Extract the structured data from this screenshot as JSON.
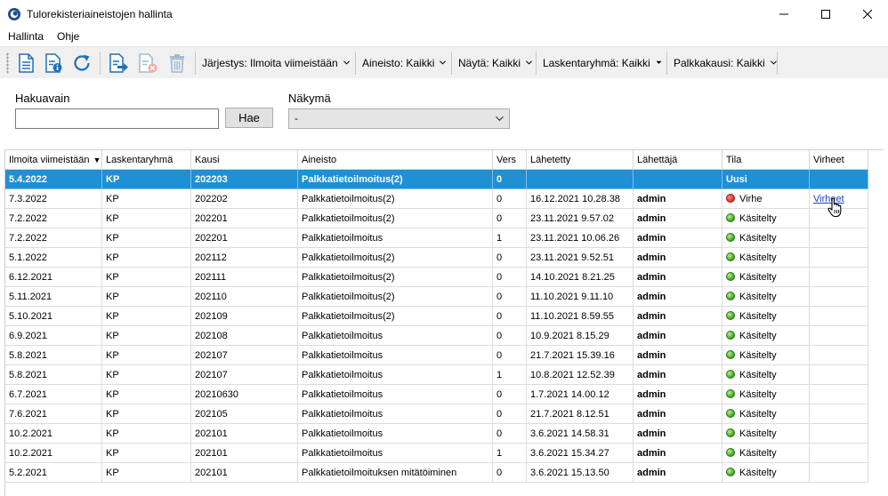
{
  "window": {
    "title": "Tulorekisteriaineistojen hallinta"
  },
  "menu": {
    "items": [
      "Hallinta",
      "Ohje"
    ]
  },
  "toolbar": {
    "dropdowns": [
      "Järjestys: Ilmoita viimeistään",
      "Aineisto: Kaikki",
      "Näytä: Kaikki",
      "Laskentaryhmä: Kaikki",
      "Palkkakausi: Kaikki"
    ]
  },
  "search": {
    "label": "Hakuavain",
    "value": "",
    "button": "Hae"
  },
  "view": {
    "label": "Näkymä",
    "selected": "-"
  },
  "grid": {
    "columns": [
      "Ilmoita viimeistään",
      "Laskentaryhmä",
      "Kausi",
      "Aineisto",
      "Vers",
      "Lähetetty",
      "Lähettäjä",
      "Tila",
      "Virheet"
    ],
    "sort_indicator": "▼",
    "rows": [
      [
        "5.4.2022",
        "KP",
        "202203",
        "Palkkatietoilmoitus(2)",
        "0",
        "",
        "",
        "Uusi",
        ""
      ],
      [
        "7.3.2022",
        "KP",
        "202202",
        "Palkkatietoilmoitus(2)",
        "0",
        "16.12.2021 10.28.38",
        "admin",
        "Virhe",
        "Virheet"
      ],
      [
        "7.2.2022",
        "KP",
        "202201",
        "Palkkatietoilmoitus(2)",
        "0",
        "23.11.2021 9.57.02",
        "admin",
        "Käsitelty",
        ""
      ],
      [
        "7.2.2022",
        "KP",
        "202201",
        "Palkkatietoilmoitus",
        "1",
        "23.11.2021 10.06.26",
        "admin",
        "Käsitelty",
        ""
      ],
      [
        "5.1.2022",
        "KP",
        "202112",
        "Palkkatietoilmoitus(2)",
        "0",
        "23.11.2021 9.52.51",
        "admin",
        "Käsitelty",
        ""
      ],
      [
        "6.12.2021",
        "KP",
        "202111",
        "Palkkatietoilmoitus(2)",
        "0",
        "14.10.2021 8.21.25",
        "admin",
        "Käsitelty",
        ""
      ],
      [
        "5.11.2021",
        "KP",
        "202110",
        "Palkkatietoilmoitus(2)",
        "0",
        "11.10.2021 9.11.10",
        "admin",
        "Käsitelty",
        ""
      ],
      [
        "5.10.2021",
        "KP",
        "202109",
        "Palkkatietoilmoitus(2)",
        "0",
        "11.10.2021 8.59.55",
        "admin",
        "Käsitelty",
        ""
      ],
      [
        "6.9.2021",
        "KP",
        "202108",
        "Palkkatietoilmoitus",
        "0",
        "10.9.2021 8.15.29",
        "admin",
        "Käsitelty",
        ""
      ],
      [
        "5.8.2021",
        "KP",
        "202107",
        "Palkkatietoilmoitus",
        "0",
        "21.7.2021 15.39.16",
        "admin",
        "Käsitelty",
        ""
      ],
      [
        "5.8.2021",
        "KP",
        "202107",
        "Palkkatietoilmoitus",
        "1",
        "10.8.2021 12.52.39",
        "admin",
        "Käsitelty",
        ""
      ],
      [
        "6.7.2021",
        "KP",
        "20210630",
        "Palkkatietoilmoitus",
        "0",
        "1.7.2021 14.00.12",
        "admin",
        "Käsitelty",
        ""
      ],
      [
        "7.6.2021",
        "KP",
        "202105",
        "Palkkatietoilmoitus",
        "0",
        "21.7.2021 8.12.51",
        "admin",
        "Käsitelty",
        ""
      ],
      [
        "10.2.2021",
        "KP",
        "202101",
        "Palkkatietoilmoitus",
        "0",
        "3.6.2021 14.58.31",
        "admin",
        "Käsitelty",
        ""
      ],
      [
        "10.2.2021",
        "KP",
        "202101",
        "Palkkatietoilmoitus",
        "1",
        "3.6.2021 15.34.27",
        "admin",
        "Käsitelty",
        ""
      ],
      [
        "5.2.2021",
        "KP",
        "202101",
        "Palkkatietoilmoituksen mitätöiminen",
        "0",
        "3.6.2021 15.13.50",
        "admin",
        "Käsitelty",
        ""
      ]
    ]
  },
  "colors": {
    "selection": "#1e90d6",
    "error": "#d32f2f",
    "ok": "#3a9d23",
    "link": "#1a3fd6"
  },
  "icons": [
    "new-document-icon",
    "document-info-icon",
    "refresh-icon",
    "export-document-icon",
    "cancel-document-icon",
    "trash-icon"
  ]
}
